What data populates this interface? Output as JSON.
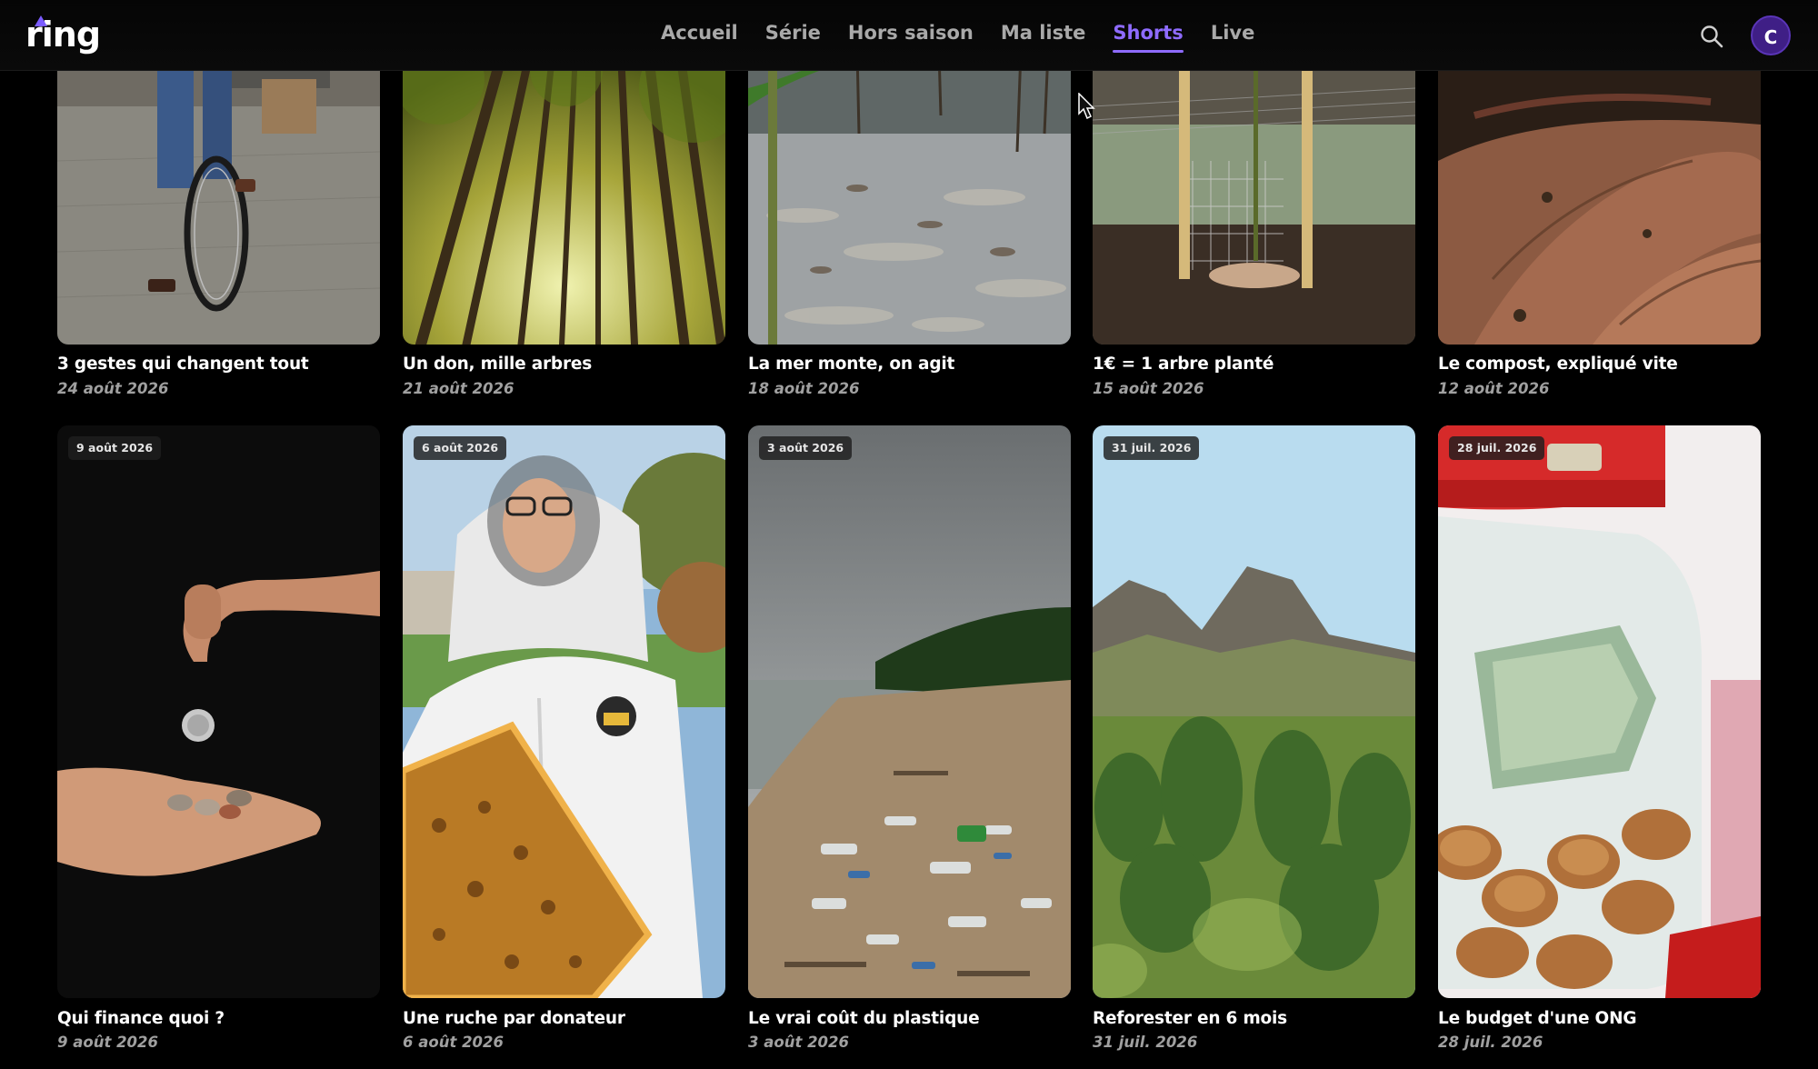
{
  "app": {
    "logo_text": "ring",
    "accent_color": "#8e6bff"
  },
  "nav": {
    "items": [
      {
        "label": "Accueil",
        "active": false
      },
      {
        "label": "Série",
        "active": false
      },
      {
        "label": "Hors saison",
        "active": false
      },
      {
        "label": "Ma liste",
        "active": false
      },
      {
        "label": "Shorts",
        "active": true
      },
      {
        "label": "Live",
        "active": false
      }
    ]
  },
  "header": {
    "search_icon": "search-icon",
    "avatar_initial": "C"
  },
  "row1": [
    {
      "title": "3 gestes qui changent tout",
      "date": "24 août 2026"
    },
    {
      "title": "Un don, mille arbres",
      "date": "21 août 2026"
    },
    {
      "title": "La mer monte, on agit",
      "date": "18 août 2026"
    },
    {
      "title": "1€ = 1 arbre planté",
      "date": "15 août 2026"
    },
    {
      "title": "Le compost, expliqué vite",
      "date": "12 août 2026"
    }
  ],
  "row2": [
    {
      "title": "Qui finance quoi ?",
      "date": "9 août 2026",
      "badge": "9 août 2026"
    },
    {
      "title": "Une ruche par donateur",
      "date": "6 août 2026",
      "badge": "6 août 2026"
    },
    {
      "title": "Le vrai coût du plastique",
      "date": "3 août 2026",
      "badge": "3 août 2026"
    },
    {
      "title": "Reforester en 6 mois",
      "date": "31 juil. 2026",
      "badge": "31 juil. 2026"
    },
    {
      "title": "Le budget d'une ONG",
      "date": "28 juil. 2026",
      "badge": "28 juil. 2026"
    }
  ]
}
